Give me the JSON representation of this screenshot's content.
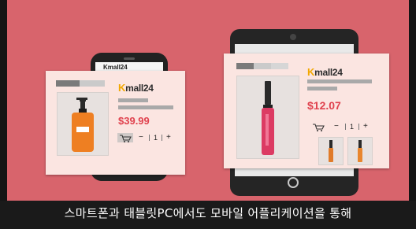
{
  "brand": {
    "logo_k": "K",
    "logo_rest": "mall24",
    "accent_color": "#f2a800",
    "price_color": "#e0424e",
    "background_color": "#d8646c"
  },
  "phone": {
    "screen_logo": "Kmall24"
  },
  "product_small": {
    "price": "$39.99",
    "quantity": "1",
    "minus_label": "−",
    "plus_label": "+",
    "icon": "lotion-bottle-icon"
  },
  "product_large": {
    "price": "$12.07",
    "quantity": "1",
    "minus_label": "−",
    "plus_label": "+",
    "icon": "lip-gloss-icon"
  },
  "subtitle": "스마트폰과 태블릿PC에서도 모바일 어플리케이션을 통해"
}
